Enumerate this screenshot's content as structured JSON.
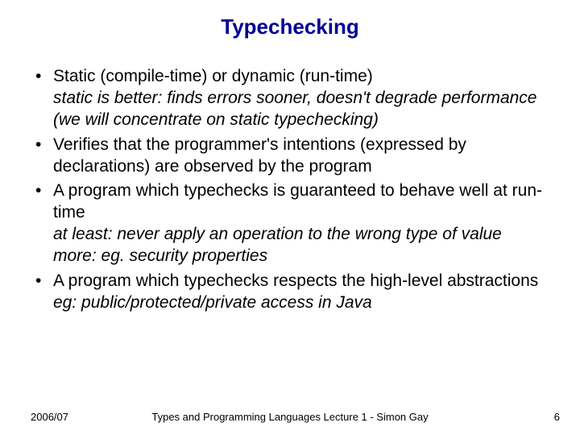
{
  "title": "Typechecking",
  "bullets": [
    {
      "main": "Static (compile-time) or dynamic (run-time)",
      "subs": [
        "static is better: finds errors sooner, doesn't degrade performance",
        "(we will concentrate on static typechecking)"
      ]
    },
    {
      "main": "Verifies that the programmer's intentions (expressed by declarations) are observed by the program",
      "subs": []
    },
    {
      "main": "A program which typechecks is guaranteed to behave well at run-time",
      "subs": [
        "at least: never apply an operation to the wrong type of value",
        "more: eg. security properties"
      ]
    },
    {
      "main": "A program which typechecks respects the high-level abstractions",
      "subs": [
        "eg: public/protected/private access in Java"
      ]
    }
  ],
  "footer": {
    "left": "2006/07",
    "center": "Types and Programming Languages Lecture 1 - Simon Gay",
    "right": "6"
  }
}
